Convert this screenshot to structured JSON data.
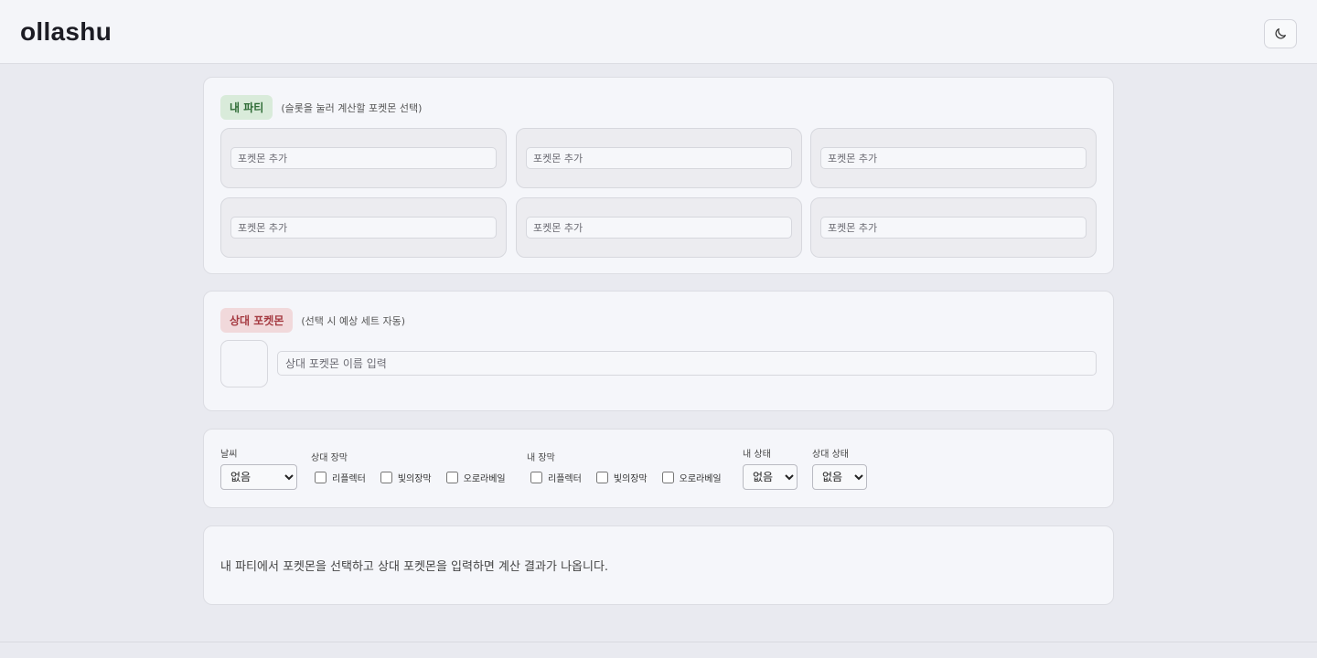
{
  "header": {
    "brand": "ollashu",
    "theme_icon": "moon-icon"
  },
  "party": {
    "title": "내 파티",
    "hint": "(슬롯을 눌러 계산할 포켓몬 선택)",
    "slots": [
      {
        "placeholder": "포켓몬 추가"
      },
      {
        "placeholder": "포켓몬 추가"
      },
      {
        "placeholder": "포켓몬 추가"
      },
      {
        "placeholder": "포켓몬 추가"
      },
      {
        "placeholder": "포켓몬 추가"
      },
      {
        "placeholder": "포켓몬 추가"
      }
    ]
  },
  "opponent": {
    "title": "상대 포켓몬",
    "hint": "(선택 시 예상 세트 자동)",
    "placeholder": "상대 포켓몬 이름 입력"
  },
  "conditions": {
    "weather": {
      "label": "날씨",
      "value": "없음"
    },
    "opp_screens": {
      "label": "상대 장막",
      "options": [
        "리플렉터",
        "빛의장막",
        "오로라베일"
      ]
    },
    "my_screens": {
      "label": "내 장막",
      "options": [
        "리플렉터",
        "빛의장막",
        "오로라베일"
      ]
    },
    "my_status": {
      "label": "내 상태",
      "value": "없음"
    },
    "opp_status": {
      "label": "상대 상태",
      "value": "없음"
    }
  },
  "result": {
    "message": "내 파티에서 포켓몬을 선택하고 상대 포켓몬을 입력하면 계산 결과가 나옵니다."
  },
  "colors": {
    "party_pill": "#d9ebda",
    "opponent_pill": "#f1d9db",
    "background": "#e9eaf0"
  }
}
